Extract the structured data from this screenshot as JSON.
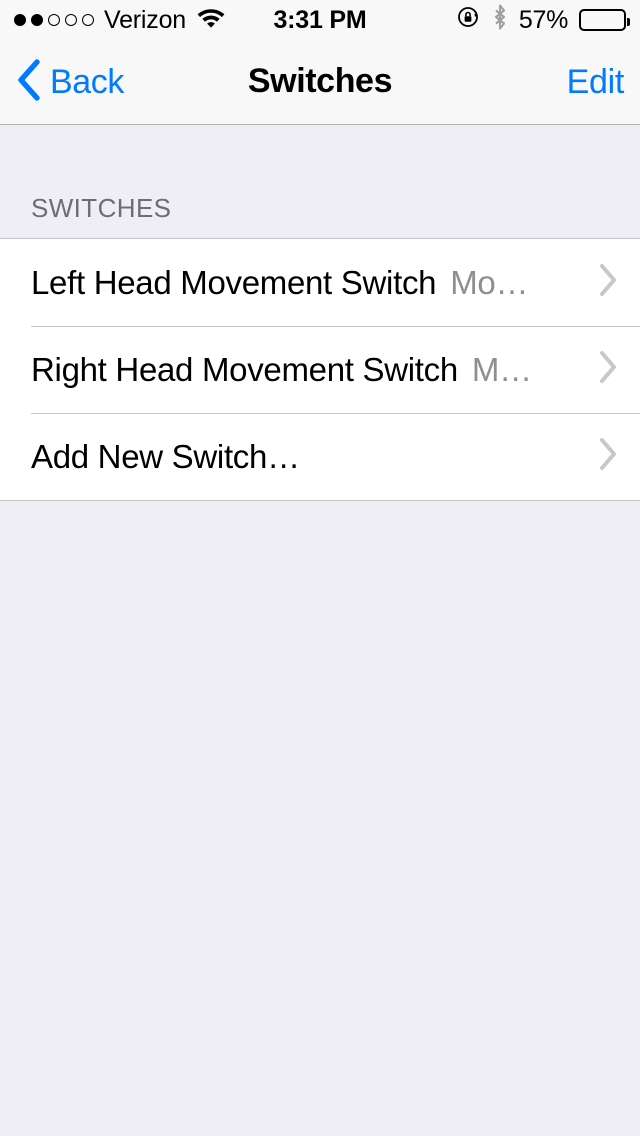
{
  "status_bar": {
    "carrier": "Verizon",
    "signal_bars_filled": 2,
    "signal_bars_total": 5,
    "wifi_icon": "wifi-icon",
    "time": "3:31 PM",
    "rotation_lock_icon": "rotation-lock-icon",
    "bluetooth_icon": "bluetooth-icon",
    "battery_percent": "57%",
    "battery_level": 57
  },
  "nav_bar": {
    "back_label": "Back",
    "back_icon": "chevron-left-icon",
    "title": "Switches",
    "edit_label": "Edit",
    "accent_color": "#007aff"
  },
  "section": {
    "header": "SWITCHES",
    "rows": [
      {
        "title": "Left Head Movement Switch",
        "value": "Mo…",
        "accessory": "chevron-right-icon"
      },
      {
        "title": "Right Head Movement Switch",
        "value": "M…",
        "accessory": "chevron-right-icon"
      },
      {
        "title": "Add New Switch…",
        "value": "",
        "accessory": "chevron-right-icon"
      }
    ]
  },
  "colors": {
    "background": "#efeef4",
    "cell_background": "#ffffff",
    "separator": "#c8c7cc",
    "secondary_text": "#8e8e93",
    "header_text": "#6d6d72"
  }
}
